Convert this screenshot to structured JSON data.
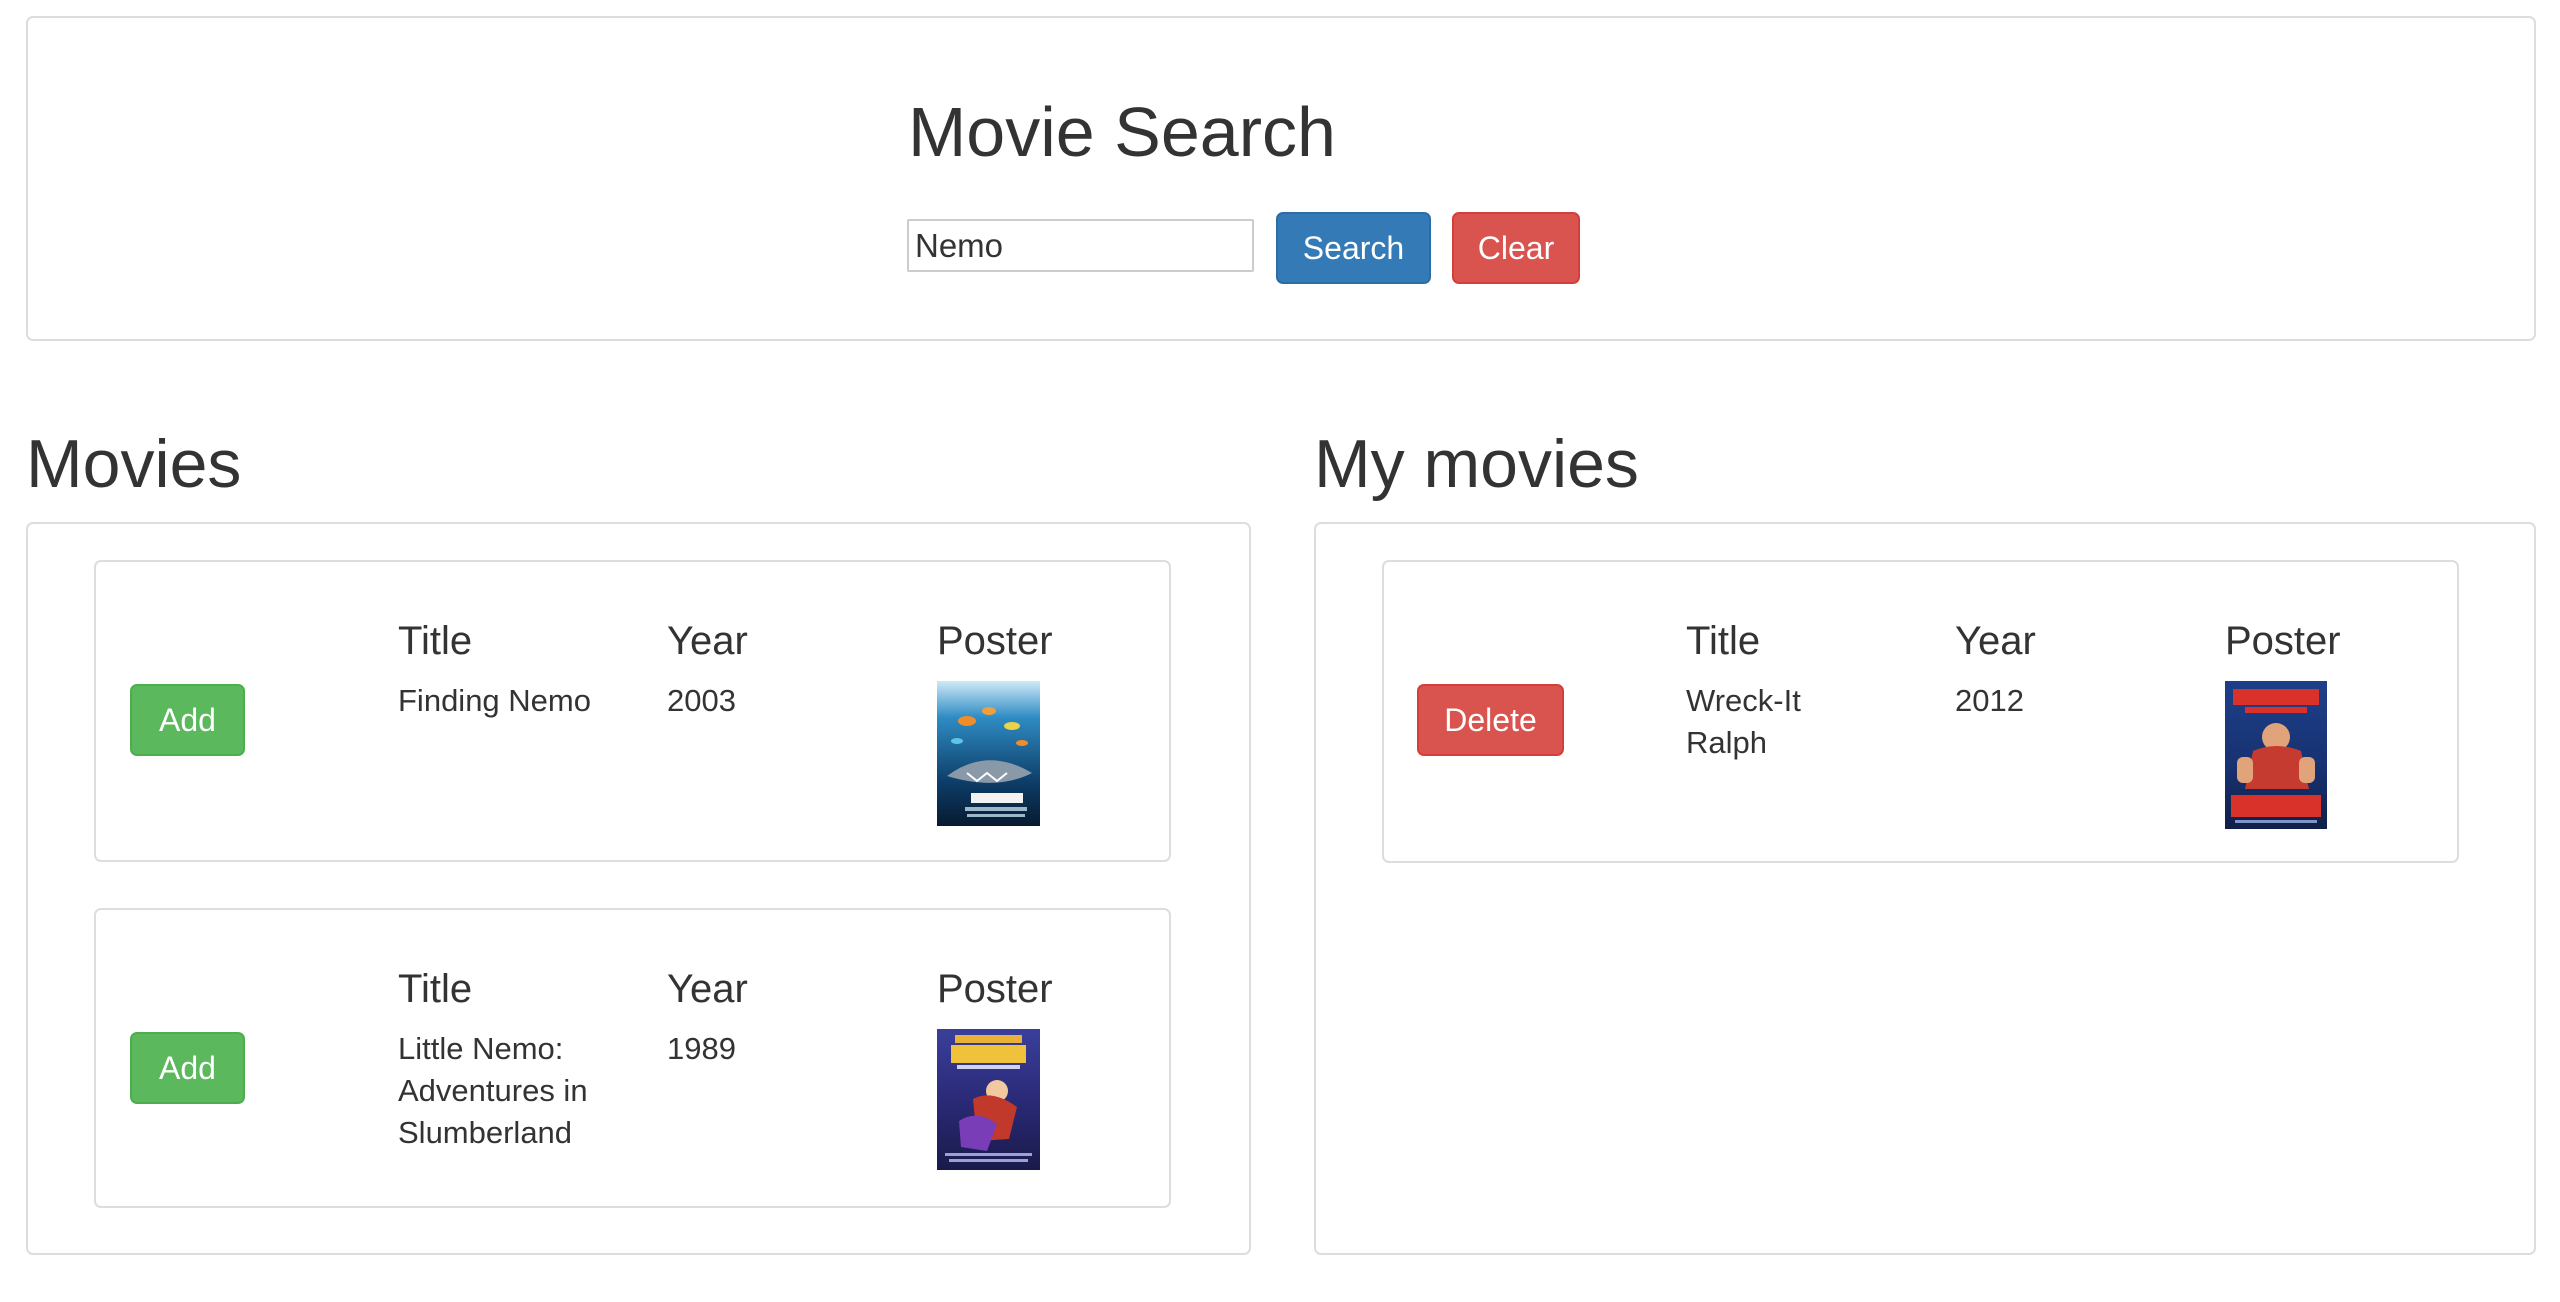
{
  "search": {
    "title": "Movie Search",
    "query": "Nemo",
    "search_label": "Search",
    "clear_label": "Clear"
  },
  "movies": {
    "heading": "Movies",
    "columns": {
      "title": "Title",
      "year": "Year",
      "poster": "Poster"
    },
    "items": [
      {
        "action_label": "Add",
        "title": "Finding Nemo",
        "year": "2003",
        "poster": "finding-nemo-poster"
      },
      {
        "action_label": "Add",
        "title": "Little Nemo: Adventures in Slumberland",
        "year": "1989",
        "poster": "little-nemo-poster"
      }
    ]
  },
  "my_movies": {
    "heading": "My movies",
    "columns": {
      "title": "Title",
      "year": "Year",
      "poster": "Poster"
    },
    "items": [
      {
        "action_label": "Delete",
        "title": "Wreck-It Ralph",
        "year": "2012",
        "poster": "wreck-it-ralph-poster"
      }
    ]
  },
  "colors": {
    "primary": "#337ab7",
    "danger": "#d9534f",
    "success": "#5cb85c",
    "border": "#dddddd",
    "text": "#333333"
  }
}
